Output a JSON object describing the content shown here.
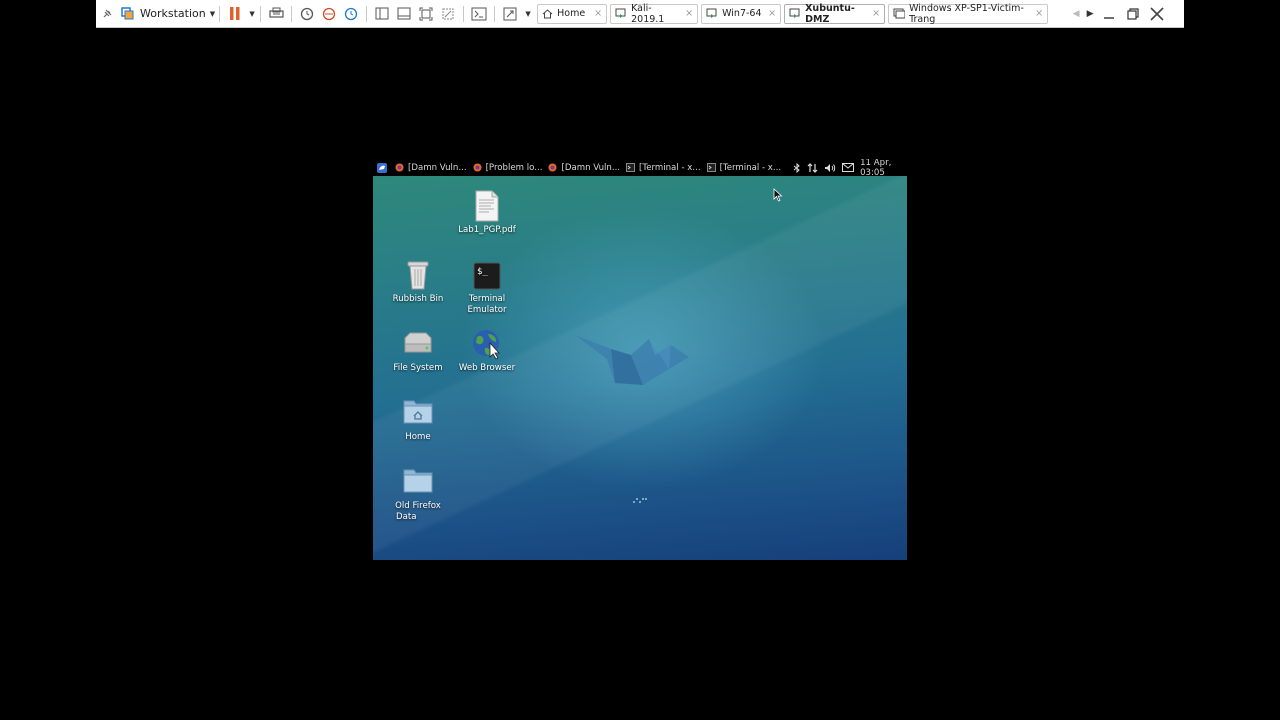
{
  "toolbar": {
    "product": "Workstation",
    "tabs": [
      {
        "label": "Home"
      },
      {
        "label": "Kali-2019.1"
      },
      {
        "label": "Win7-64"
      },
      {
        "label": "Xubuntu-DMZ",
        "active": true
      },
      {
        "label": "Windows XP-SP1-Victim-Trang"
      }
    ]
  },
  "guest": {
    "panel": {
      "tasks": [
        {
          "label": "[Damn Vuln..."
        },
        {
          "label": "[Problem lo..."
        },
        {
          "label": "[Damn Vuln..."
        },
        {
          "label": "[Terminal - x..."
        },
        {
          "label": "[Terminal - x..."
        }
      ],
      "clock": "11 Apr, 03:05"
    },
    "desktop_icons": {
      "lab_pdf": "Lab1_PGP.pdf",
      "rubbish_bin": "Rubbish Bin",
      "terminal_line1": "Terminal",
      "terminal_line2": "Emulator",
      "file_system": "File System",
      "web_browser": "Web Browser",
      "home": "Home",
      "old_firefox_line1": "Old Firefox",
      "old_firefox_line2": "Data"
    },
    "terminal_prompt": "$_"
  },
  "colors": {
    "panel_bg": "#000000",
    "desktop_top": "#2f8a78",
    "desktop_bottom": "#163f7a"
  }
}
